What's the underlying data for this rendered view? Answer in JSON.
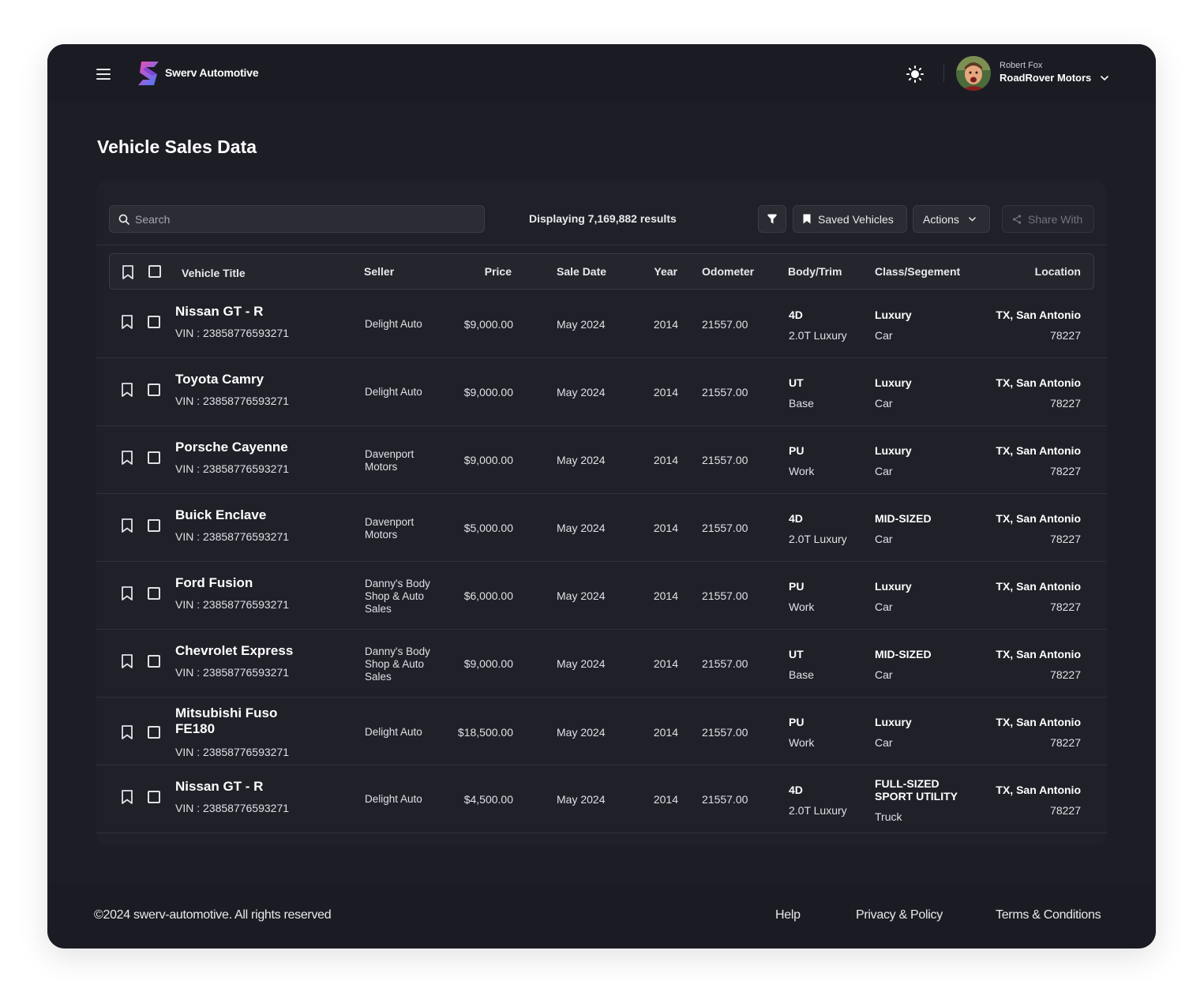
{
  "brand": {
    "name": "Swerv Automotive",
    "gradient_start": "#f24bb0",
    "gradient_end": "#3d7bff"
  },
  "header": {
    "user_name": "Robert Fox",
    "org_name": "RoadRover Motors"
  },
  "page": {
    "title": "Vehicle Sales Data"
  },
  "toolbar": {
    "search_placeholder": "Search",
    "results_text": "Displaying 7,169,882 results",
    "saved_label": "Saved Vehicles",
    "actions_label": "Actions",
    "share_label": "Share With"
  },
  "columns": {
    "vehicle_title": "Vehicle Title",
    "seller": "Seller",
    "price": "Price",
    "sale_date": "Sale Date",
    "year": "Year",
    "odometer": "Odometer",
    "body_trim": "Body/Trim",
    "class_segment": "Class/Segement",
    "location": "Location"
  },
  "rows": [
    {
      "title": "Nissan GT - R",
      "vin": "VIN : 23858776593271",
      "seller": "Delight Auto",
      "price": "$9,000.00",
      "sale_date": "May 2024",
      "year": "2014",
      "odometer": "21557.00",
      "body": "4D",
      "trim": "2.0T Luxury",
      "class": "Luxury",
      "segment": "Car",
      "location": "TX, San Antonio",
      "zip": "78227"
    },
    {
      "title": "Toyota Camry",
      "vin": "VIN : 23858776593271",
      "seller": "Delight Auto",
      "price": "$9,000.00",
      "sale_date": "May 2024",
      "year": "2014",
      "odometer": "21557.00",
      "body": "UT",
      "trim": "Base",
      "class": "Luxury",
      "segment": "Car",
      "location": "TX, San Antonio",
      "zip": "78227"
    },
    {
      "title": "Porsche Cayenne",
      "vin": "VIN : 23858776593271",
      "seller": "Davenport Motors",
      "price": "$9,000.00",
      "sale_date": "May 2024",
      "year": "2014",
      "odometer": "21557.00",
      "body": "PU",
      "trim": "Work",
      "class": "Luxury",
      "segment": "Car",
      "location": "TX, San Antonio",
      "zip": "78227"
    },
    {
      "title": "Buick Enclave",
      "vin": "VIN : 23858776593271",
      "seller": "Davenport Motors",
      "price": "$5,000.00",
      "sale_date": "May 2024",
      "year": "2014",
      "odometer": "21557.00",
      "body": "4D",
      "trim": "2.0T Luxury",
      "class": "MID-SIZED",
      "segment": "Car",
      "location": "TX, San Antonio",
      "zip": "78227"
    },
    {
      "title": "Ford Fusion",
      "vin": "VIN : 23858776593271",
      "seller": "Danny's Body Shop & Auto Sales",
      "price": "$6,000.00",
      "sale_date": "May 2024",
      "year": "2014",
      "odometer": "21557.00",
      "body": "PU",
      "trim": "Work",
      "class": "Luxury",
      "segment": "Car",
      "location": "TX, San Antonio",
      "zip": "78227"
    },
    {
      "title": "Chevrolet Express",
      "vin": "VIN : 23858776593271",
      "seller": "Danny's Body Shop & Auto Sales",
      "price": "$9,000.00",
      "sale_date": "May 2024",
      "year": "2014",
      "odometer": "21557.00",
      "body": "UT",
      "trim": "Base",
      "class": "MID-SIZED",
      "segment": "Car",
      "location": "TX, San Antonio",
      "zip": "78227"
    },
    {
      "title": "Mitsubishi Fuso FE180",
      "vin": "VIN : 23858776593271",
      "seller": "Delight Auto",
      "price": "$18,500.00",
      "sale_date": "May 2024",
      "year": "2014",
      "odometer": "21557.00",
      "body": "PU",
      "trim": "Work",
      "class": "Luxury",
      "segment": "Car",
      "location": "TX, San Antonio",
      "zip": "78227"
    },
    {
      "title": "Nissan GT - R",
      "vin": "VIN : 23858776593271",
      "seller": "Delight Auto",
      "price": "$4,500.00",
      "sale_date": "May 2024",
      "year": "2014",
      "odometer": "21557.00",
      "body": "4D",
      "trim": "2.0T Luxury",
      "class": "FULL-SIZED SPORT UTILITY",
      "segment": "Truck",
      "location": "TX, San Antonio",
      "zip": "78227"
    }
  ],
  "footer": {
    "copyright": "©2024 swerv-automotive. All rights reserved",
    "help": "Help",
    "privacy": "Privacy & Policy",
    "terms": "Terms & Conditions"
  },
  "icons": [
    "menu-icon",
    "sun-icon",
    "chevron-down-icon",
    "search-icon",
    "filter-icon",
    "bookmark-icon",
    "share-icon",
    "checkbox-icon"
  ]
}
